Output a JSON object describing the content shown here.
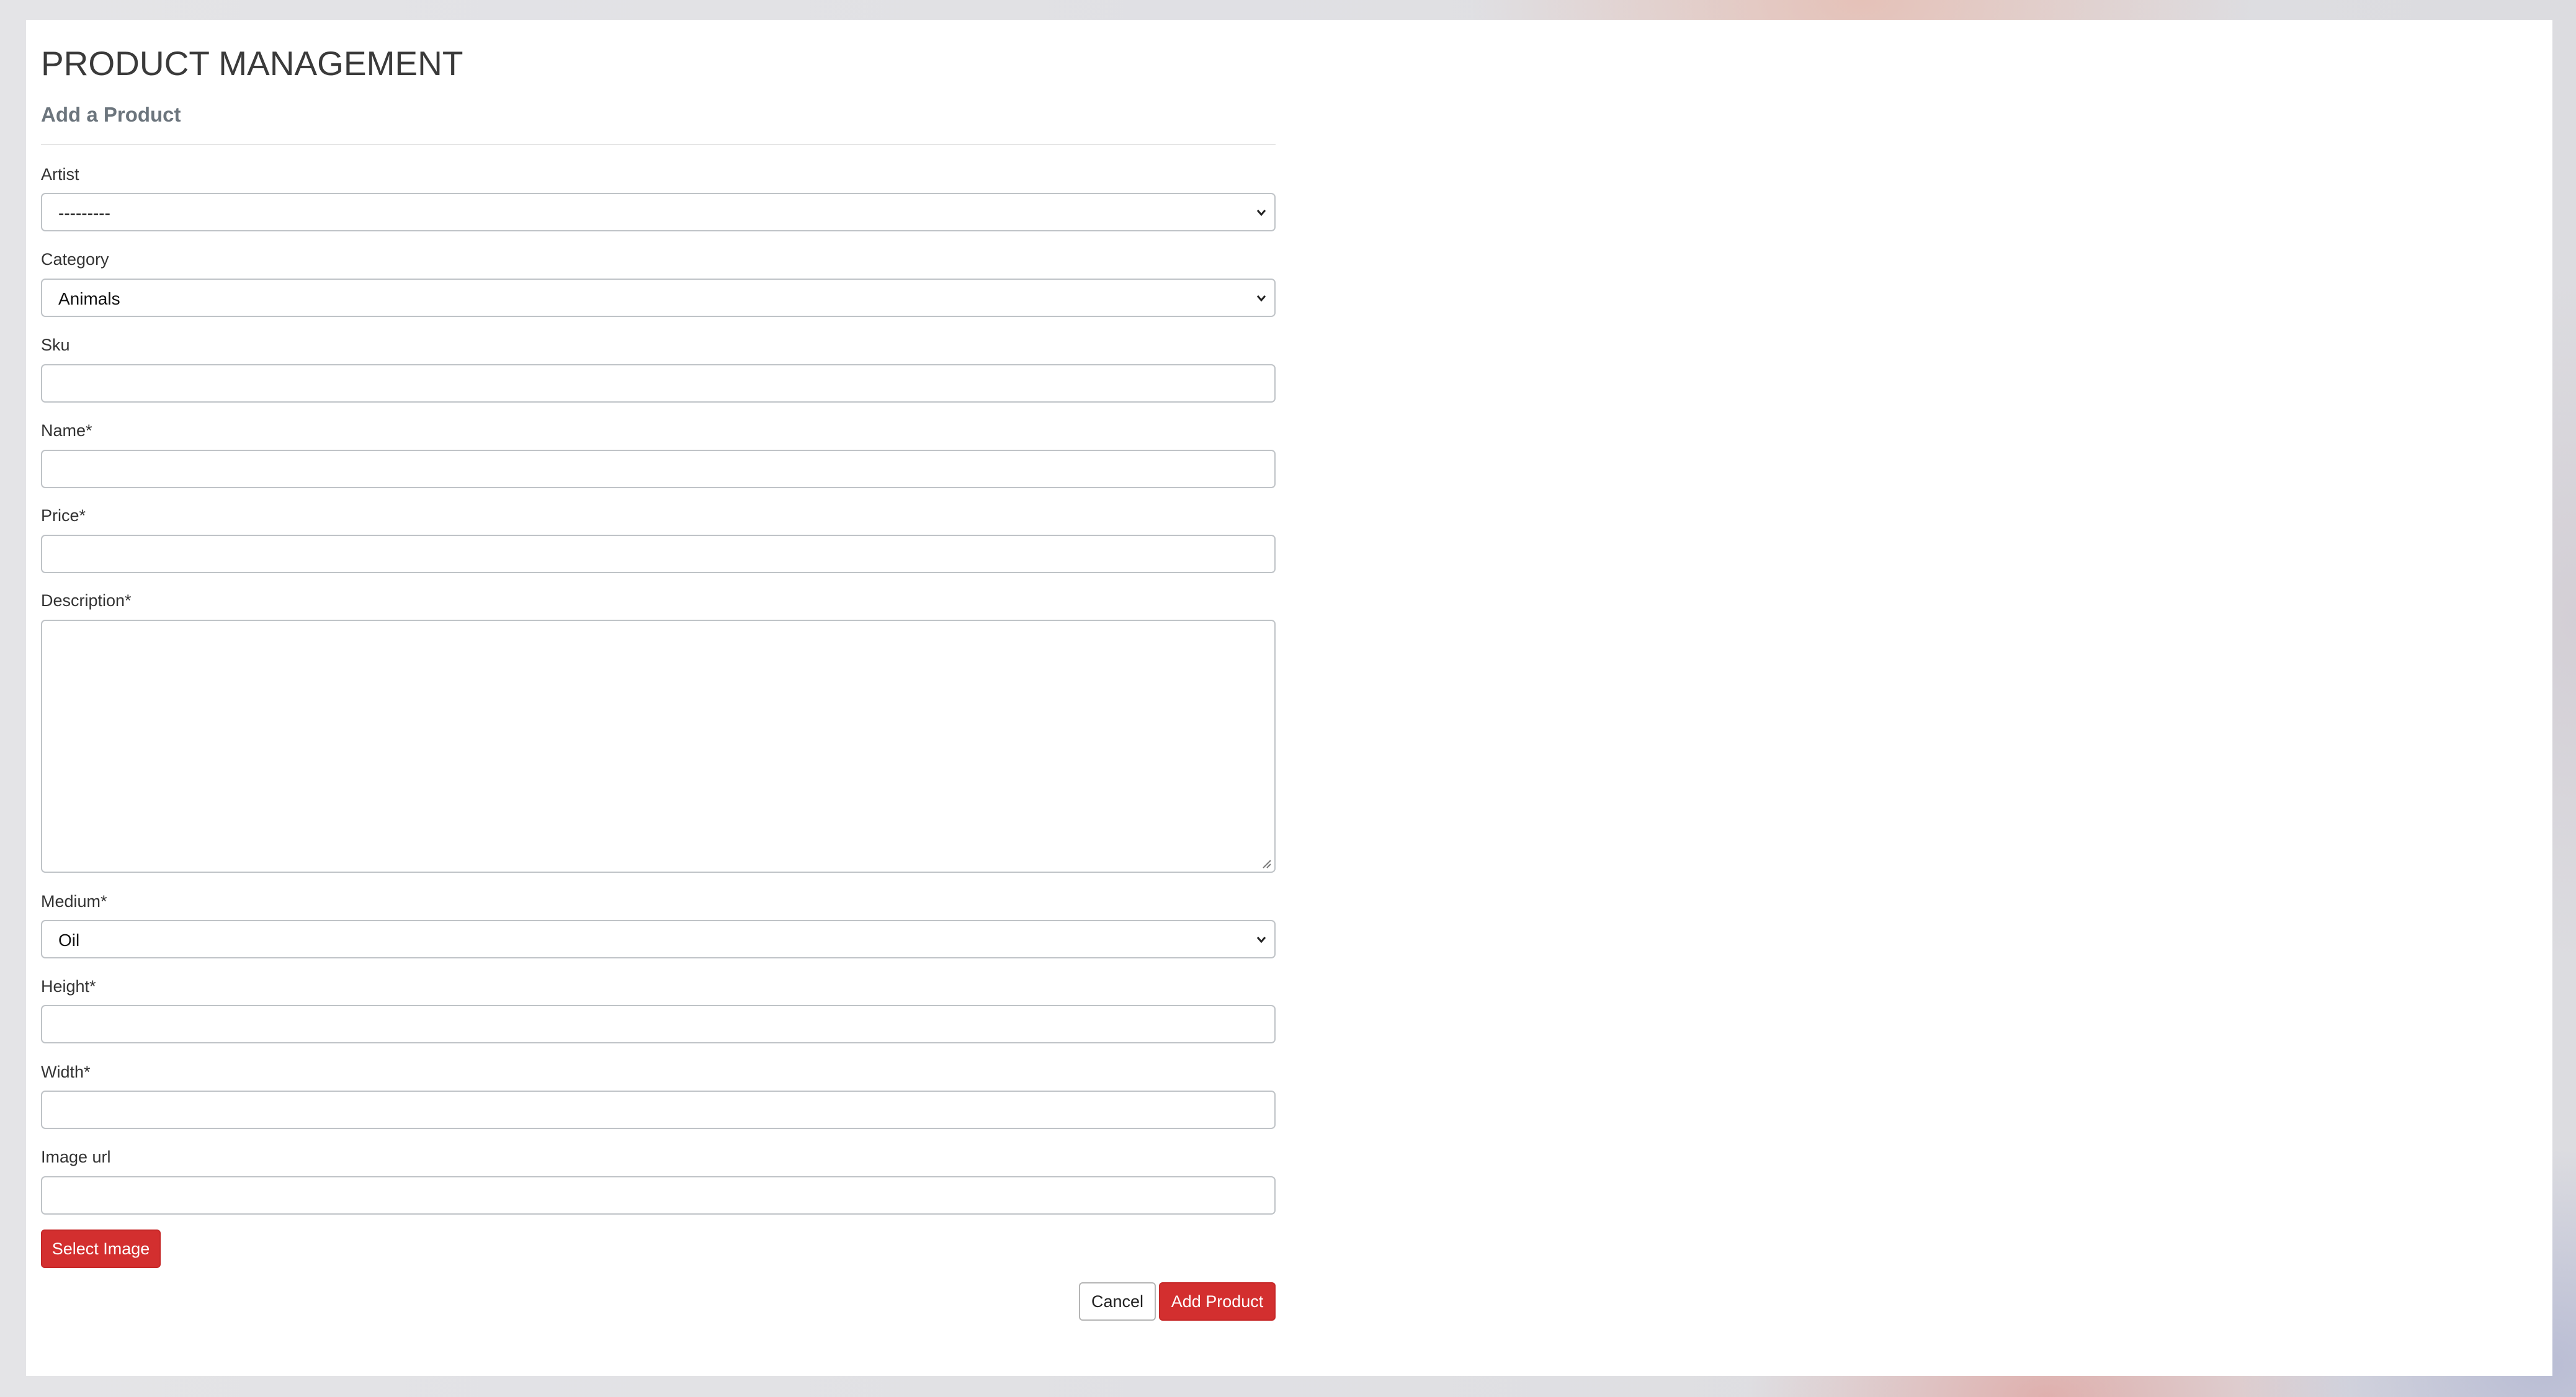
{
  "page": {
    "title": "PRODUCT MANAGEMENT",
    "subtitle": "Add a Product"
  },
  "form": {
    "artist": {
      "label": "Artist",
      "value": "---------"
    },
    "category": {
      "label": "Category",
      "value": "Animals"
    },
    "sku": {
      "label": "Sku",
      "value": ""
    },
    "name": {
      "label": "Name*",
      "value": ""
    },
    "price": {
      "label": "Price*",
      "value": ""
    },
    "description": {
      "label": "Description*",
      "value": ""
    },
    "medium": {
      "label": "Medium*",
      "value": "Oil"
    },
    "height": {
      "label": "Height*",
      "value": ""
    },
    "width": {
      "label": "Width*",
      "value": ""
    },
    "image_url": {
      "label": "Image url",
      "value": ""
    }
  },
  "buttons": {
    "select_image": "Select Image",
    "cancel": "Cancel",
    "add_product": "Add Product"
  },
  "icons": {
    "select_chevron": "chevron-down-icon",
    "textarea_grip": "resize-grip-icon"
  },
  "colors": {
    "accent": "#d32f2f",
    "border": "#bfc3c7",
    "subtitle": "#6c757d"
  }
}
